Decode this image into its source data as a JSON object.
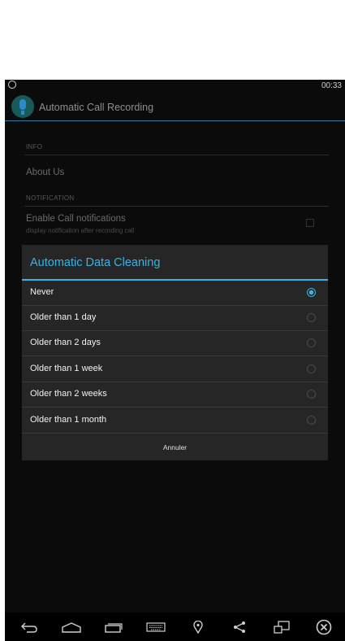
{
  "status_bar": {
    "time": "00:33",
    "notification_icon": "whatsapp-icon"
  },
  "app": {
    "title": "Automatic Call Recording",
    "icon": "microphone-icon"
  },
  "settings": {
    "info_header": "INFO",
    "about": "About Us",
    "notification_header": "NOTIFICATION",
    "call_notifications": {
      "title": "Enable Call notifications",
      "summary": "display notification after recording call"
    }
  },
  "dialog": {
    "title": "Automatic Data Cleaning",
    "options": [
      {
        "label": "Never",
        "selected": true
      },
      {
        "label": "Older than 1 day",
        "selected": false
      },
      {
        "label": "Older than 2 days",
        "selected": false
      },
      {
        "label": "Older than 1 week",
        "selected": false
      },
      {
        "label": "Older than 2 weeks",
        "selected": false
      },
      {
        "label": "Older than 1 month",
        "selected": false
      }
    ],
    "cancel": "Annuler"
  },
  "nav_bar": [
    "back-icon",
    "home-icon",
    "recent-apps-icon",
    "keyboard-icon",
    "location-icon",
    "share-icon",
    "screen-resize-icon",
    "close-icon"
  ],
  "colors": {
    "accent": "#35b5e5",
    "background": "#0b0b0b",
    "dialog": "#262626"
  }
}
